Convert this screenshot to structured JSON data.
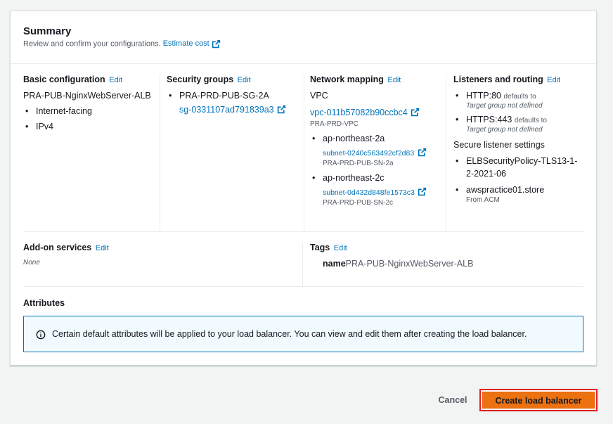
{
  "summary": {
    "title": "Summary",
    "description": "Review and confirm your configurations.",
    "estimate_link": "Estimate cost"
  },
  "edit_label": "Edit",
  "basic": {
    "heading": "Basic configuration",
    "name": "PRA-PUB-NginxWebServer-ALB",
    "items": [
      "Internet-facing",
      "IPv4"
    ]
  },
  "security": {
    "heading": "Security groups",
    "group_name": "PRA-PRD-PUB-SG-2A",
    "group_id": "sg-0331107ad791839a3"
  },
  "network": {
    "heading": "Network mapping",
    "vpc_label": "VPC",
    "vpc_id": "vpc-011b57082b90ccbc4",
    "vpc_name": "PRA-PRD-VPC",
    "zones": [
      {
        "az": "ap-northeast-2a",
        "subnet_id": "subnet-0240c563492cf2d83",
        "subnet_name": "PRA-PRD-PUB-SN-2a"
      },
      {
        "az": "ap-northeast-2c",
        "subnet_id": "subnet-0d432d848fe1573c3",
        "subnet_name": "PRA-PRD-PUB-SN-2c"
      }
    ]
  },
  "listeners": {
    "heading": "Listeners and routing",
    "items": [
      {
        "protocol": "HTTP:80",
        "defaults": "defaults to",
        "target": "Target group not defined"
      },
      {
        "protocol": "HTTPS:443",
        "defaults": "defaults to",
        "target": "Target group not defined"
      }
    ],
    "secure_heading": "Secure listener settings",
    "policy_line1": "ELBSecurityPolicy-TLS13-1-",
    "policy_line2": "2-2021-06",
    "cert": "awspractice01.store",
    "cert_source": "From ACM"
  },
  "addons": {
    "heading": "Add-on services",
    "value": "None"
  },
  "tags": {
    "heading": "Tags",
    "key": "name",
    "value": "PRA-PUB-NginxWebServer-ALB"
  },
  "attributes": {
    "heading": "Attributes",
    "info": "Certain default attributes will be applied to your load balancer. You can view and edit them after creating the load balancer."
  },
  "footer": {
    "cancel": "Cancel",
    "create": "Create load balancer"
  },
  "colors": {
    "link": "#0073bb",
    "primary_button": "#ec7211",
    "highlight_border": "#e02020"
  }
}
